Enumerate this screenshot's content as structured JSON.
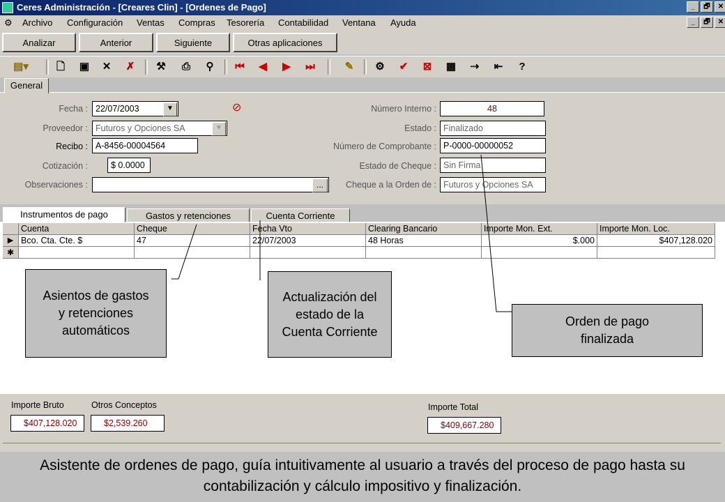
{
  "window": {
    "title": "Ceres Administración - [Creares Clin] - [Ordenes de Pago]",
    "controls": [
      "_",
      "🗗",
      "✕"
    ]
  },
  "menu": [
    "Archivo",
    "Configuración",
    "Ventas",
    "Compras",
    "Tesorería",
    "Contabilidad",
    "Ventana",
    "Ayuda"
  ],
  "nav_buttons": [
    "Analizar",
    "Anterior",
    "Siguiente",
    "Otras aplicaciones"
  ],
  "toolbar_icons": [
    "form-dropdown-icon",
    "new-icon",
    "save-icon",
    "delete-icon",
    "undo-icon",
    "wizard-icon",
    "print-icon",
    "find-icon",
    "first-record-icon",
    "previous-record-icon",
    "next-record-icon",
    "last-record-icon",
    "notes-icon",
    "tools-icon",
    "check-icon",
    "cancel-icon",
    "report-icon",
    "link-icon",
    "exit-icon",
    "help-icon"
  ],
  "tabs": {
    "general": "General"
  },
  "form": {
    "fecha_label": "Fecha :",
    "fecha": "22/07/2003",
    "proveedor_label": "Proveedor :",
    "proveedor": "Futuros y Opciones SA",
    "recibo_label": "Recibo :",
    "recibo": "A-8456-00004564",
    "cotizacion_label": "Cotización :",
    "cotizacion": "$ 0.0000",
    "observaciones_label": "Observaciones :",
    "observaciones": "",
    "observaciones_btn": "...",
    "numero_interno_label": "Número Interno :",
    "numero_interno": "48",
    "estado_label": "Estado :",
    "estado": "Finalizado",
    "comprobante_label": "Número de Comprobante :",
    "comprobante": "P-0000-00000052",
    "estado_cheque_label": "Estado de Cheque :",
    "estado_cheque": "Sin Firma",
    "cheque_orden_label": "Cheque a la Orden de :",
    "cheque_orden": "Futuros y Opciones SA"
  },
  "subtabs": [
    "Instrumentos de pago",
    "Gastos y retenciones",
    "Cuenta Corriente"
  ],
  "grid": {
    "columns": [
      "Cuenta",
      "Cheque",
      "Fecha Vto",
      "Clearing Bancario",
      "Importe Mon. Ext.",
      "Importe Mon. Loc."
    ],
    "rows": [
      [
        "Bco. Cta. Cte. $",
        "47",
        "22/07/2003",
        "48 Horas",
        "$.000",
        "$407,128.020"
      ]
    ],
    "current_marker": "▶",
    "new_marker": "✱"
  },
  "callouts": {
    "gastos": "Asientos de gastos y retenciones automáticos",
    "cuenta": "Actualización del estado de la Cuenta Corriente",
    "orden": "Orden de pago finalizada"
  },
  "totals": {
    "bruto_label": "Importe Bruto",
    "bruto": "$407,128.020",
    "otros_label": "Otros Conceptos",
    "otros": "$2,539.260",
    "total_label": "Importe Total",
    "total": "$409,667.280"
  },
  "caption": "Asistente de ordenes de pago, guía intuitivamente al usuario a través del proceso de pago hasta su contabilización y cálculo impositivo y finalización."
}
